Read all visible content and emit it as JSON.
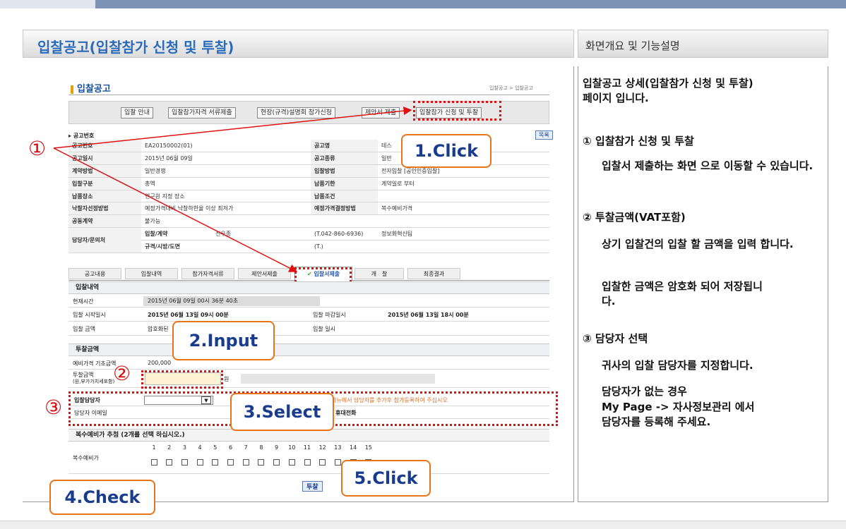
{
  "header": {
    "title": "입찰공고(입찰참가 신청 및 투찰)",
    "right_title": "화면개요 및 기능설명"
  },
  "shot": {
    "title": "입찰공고",
    "breadcrumb": "입찰공고 > 입찰공고",
    "tabs": [
      "입찰 안내",
      "입찰참가자격 서류제출",
      "현장(규격)설명회 참가신청",
      "제안서 제출",
      "입찰참가 신청 및 투찰"
    ],
    "section_notice": "▸ 공고번호",
    "list_button": "목록",
    "info": {
      "r1": [
        "공고번호",
        "EA20150002(01)",
        "공고명",
        "테스"
      ],
      "r2": [
        "공고일시",
        "2015년 06월 09일",
        "공고종류",
        "일반"
      ],
      "r3": [
        "계약방법",
        "일반경쟁",
        "입찰방법",
        "전자입찰 [공인인증입찰]"
      ],
      "r4": [
        "입찰구분",
        "총액",
        "납품기한",
        "계약일로 부터"
      ],
      "r5": [
        "납품장소",
        "연구원 지정 장소",
        "납품조건",
        ""
      ],
      "r6": [
        "낙찰자선정방법",
        "예정가격대비 낙찰하한율 이상 최저가",
        "예정가격결정방법",
        "복수예비가격"
      ],
      "r7": [
        "공동계약",
        "불가능",
        "",
        ""
      ],
      "r8": [
        "담당자/문의처",
        "입찰/계약",
        "신우종",
        "(T.042-860-6936)",
        "정보화혁신팀"
      ],
      "r9": [
        "규격/시방/도면",
        "(T.)"
      ]
    },
    "subtabs": [
      "공고내용",
      "입찰내역",
      "참가자격서류",
      "제안서제출",
      "입찰서제출",
      "개　찰",
      "최종결과"
    ],
    "bid": {
      "title": "입찰내역",
      "now_label": "현재시간",
      "now_value": "2015년 06월 09일 00시 36분 40초",
      "start_label": "입찰 시작일시",
      "start_value": "2015년 06월 13일 09시 00분",
      "end_label": "입찰 마감일시",
      "end_value": "2015년 06월 13일 18시 00분",
      "amount_label": "입찰 금액",
      "amount_value": "암호화된",
      "date_label": "입찰 일시"
    },
    "price": {
      "title": "투찰금액",
      "base_label": "예비가격 기초금액",
      "base_value": "200,000",
      "amt_label": "투찰금액",
      "amt_label2": "(원,부가가치세포함)",
      "won": "원"
    },
    "person": {
      "label": "입찰담당자",
      "notice": "메뉴에서 담당자를 추가후 참가등록하여 주십시오",
      "email_label": "담당자 이메일",
      "phone_label": "휴대전화"
    },
    "multi": {
      "title": "복수예비가 추첨 (2개를 선택 하십시오.)",
      "label": "복수예비가",
      "numbers": [
        "1",
        "2",
        "3",
        "4",
        "5",
        "6",
        "7",
        "8",
        "9",
        "10",
        "11",
        "12",
        "13",
        "14",
        "15"
      ]
    },
    "submit": "투찰"
  },
  "callouts": {
    "c1": "1.Click",
    "c2": "2.Input",
    "c3": "3.Select",
    "c4": "4.Check",
    "c5": "5.Click"
  },
  "circles": {
    "a": "①",
    "b": "②",
    "c": "③"
  },
  "right": {
    "intro": "입찰공고 상세(입찰참가 신청 및 투찰)<br>페이지 입니다.",
    "h1": "① 입찰참가 신청 및 투찰",
    "p1": "입찰서 제출하는 화면 으로 이동할 수 있습니다.",
    "h2": "② 투찰금액(VAT포함)",
    "p2a": "상기 입찰건의 입찰 할 금액을 입력 합니다.",
    "p2b": "입찰한 금액은 암호화 되어 저장됩니다.",
    "h3": "③ 담당자 선택",
    "p3a": "귀사의 입찰 담당자를 지정합니다.",
    "p3b1": "담당자가 없는 경우",
    "p3b2": "My Page -> 자사정보관리 에서",
    "p3b3": "담당자를 등록해 주세요."
  }
}
